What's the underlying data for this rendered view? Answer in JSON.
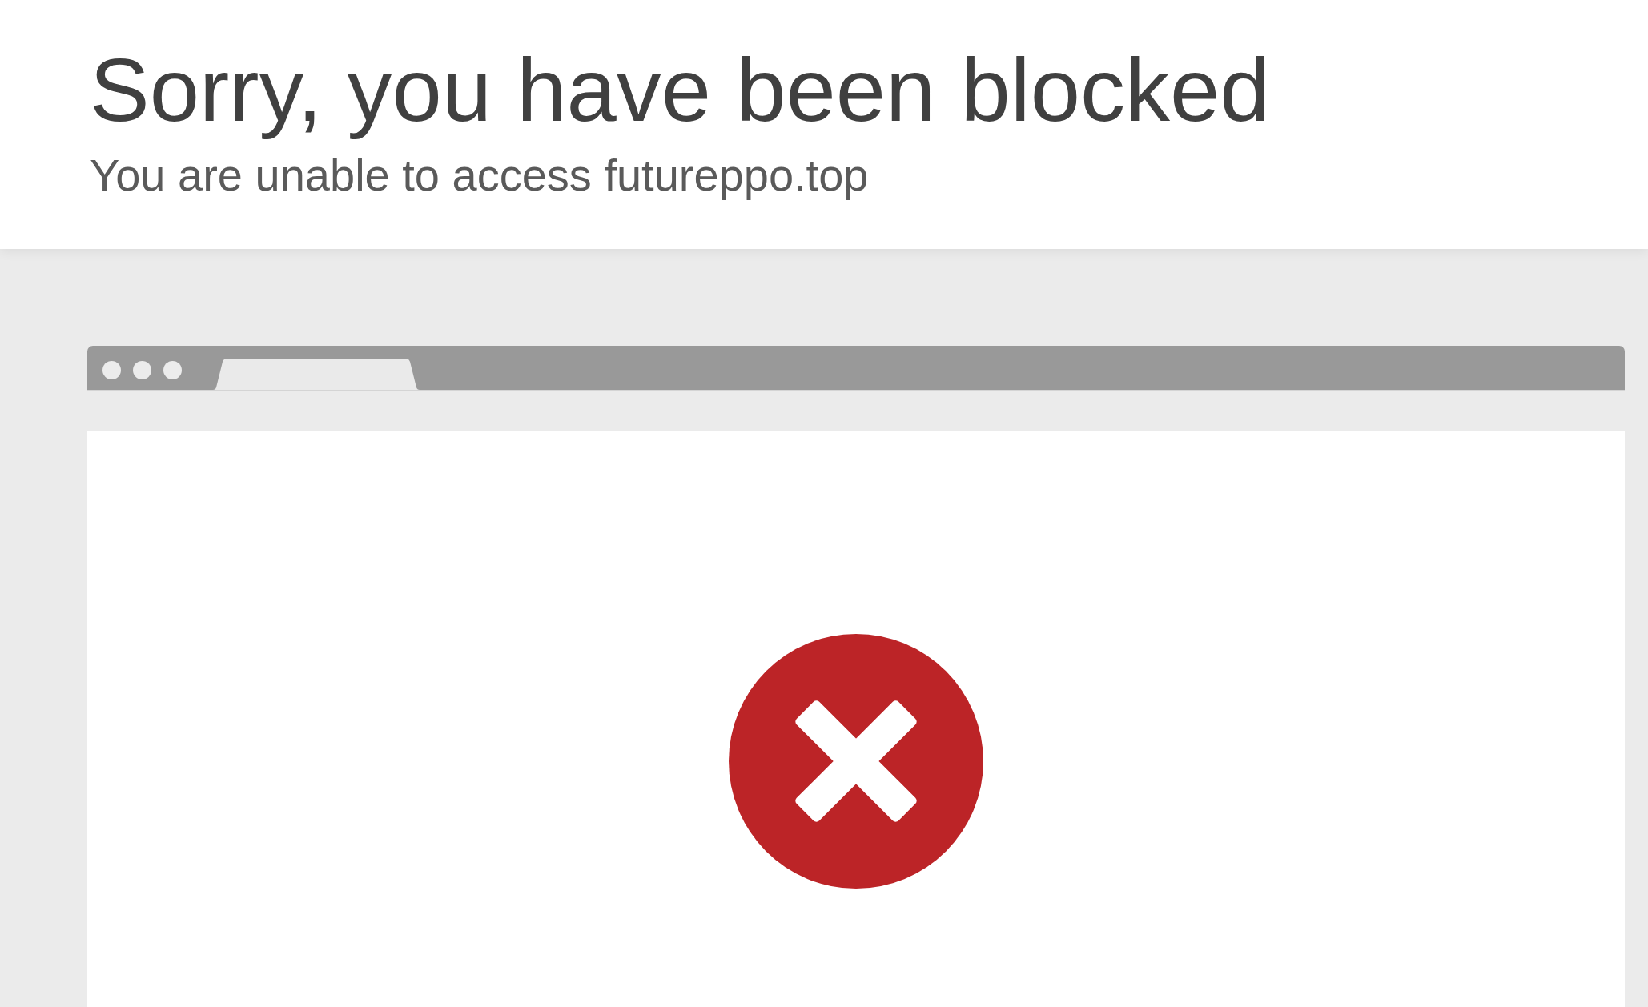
{
  "header": {
    "title": "Sorry, you have been blocked",
    "subtitle": "You are unable to access futureppo.top"
  }
}
